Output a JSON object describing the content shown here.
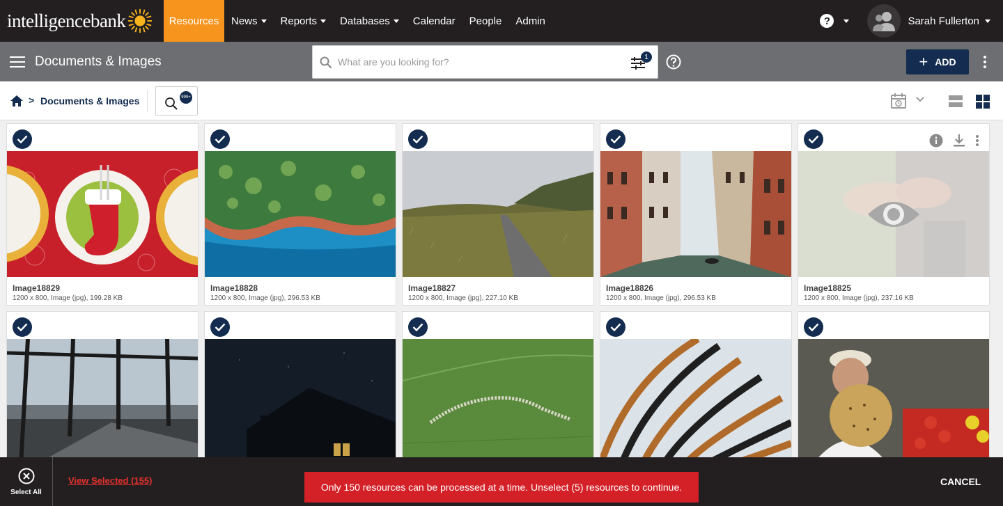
{
  "topnav": {
    "logo_text": "intelligencebank",
    "items": [
      {
        "label": "Resources",
        "active": true,
        "dropdown": false
      },
      {
        "label": "News",
        "dropdown": true
      },
      {
        "label": "Reports",
        "dropdown": true
      },
      {
        "label": "Databases",
        "dropdown": true
      },
      {
        "label": "Calendar",
        "dropdown": false
      },
      {
        "label": "People",
        "dropdown": false
      },
      {
        "label": "Admin",
        "dropdown": false
      }
    ],
    "help_label": "?",
    "user_name": "Sarah Fullerton"
  },
  "subbar": {
    "title": "Documents & Images",
    "search_placeholder": "What are you looking for?",
    "filter_count": "1",
    "add_label": "ADD"
  },
  "breadcrumb": {
    "current": "Documents & Images",
    "separator": ">",
    "saved_search_badge": "999+"
  },
  "cards": [
    {
      "title": "Image18829",
      "meta": "1200 x 800, Image (jpg), 199.28 KB"
    },
    {
      "title": "Image18828",
      "meta": "1200 x 800, Image (jpg), 296.53 KB"
    },
    {
      "title": "Image18827",
      "meta": "1200 x 800, Image (jpg), 227.10 KB"
    },
    {
      "title": "Image18826",
      "meta": "1200 x 800, Image (jpg), 296.53 KB"
    },
    {
      "title": "Image18825",
      "meta": "1200 x 800, Image (jpg), 237.16 KB"
    },
    {
      "title": "",
      "meta": ""
    },
    {
      "title": "",
      "meta": ""
    },
    {
      "title": "",
      "meta": ""
    },
    {
      "title": "",
      "meta": ""
    },
    {
      "title": "",
      "meta": ""
    }
  ],
  "footer": {
    "select_all_label": "Select All",
    "view_selected_label": "View Selected (155)",
    "warning_text": "Only 150 resources can be processed at a time. Unselect (5) resources to continue.",
    "cancel_label": "CANCEL"
  },
  "colors": {
    "accent": "#f7941d",
    "navy": "#132c4f",
    "warning": "#d42128",
    "topbar": "#231f20",
    "subbar": "#6d6e71"
  }
}
